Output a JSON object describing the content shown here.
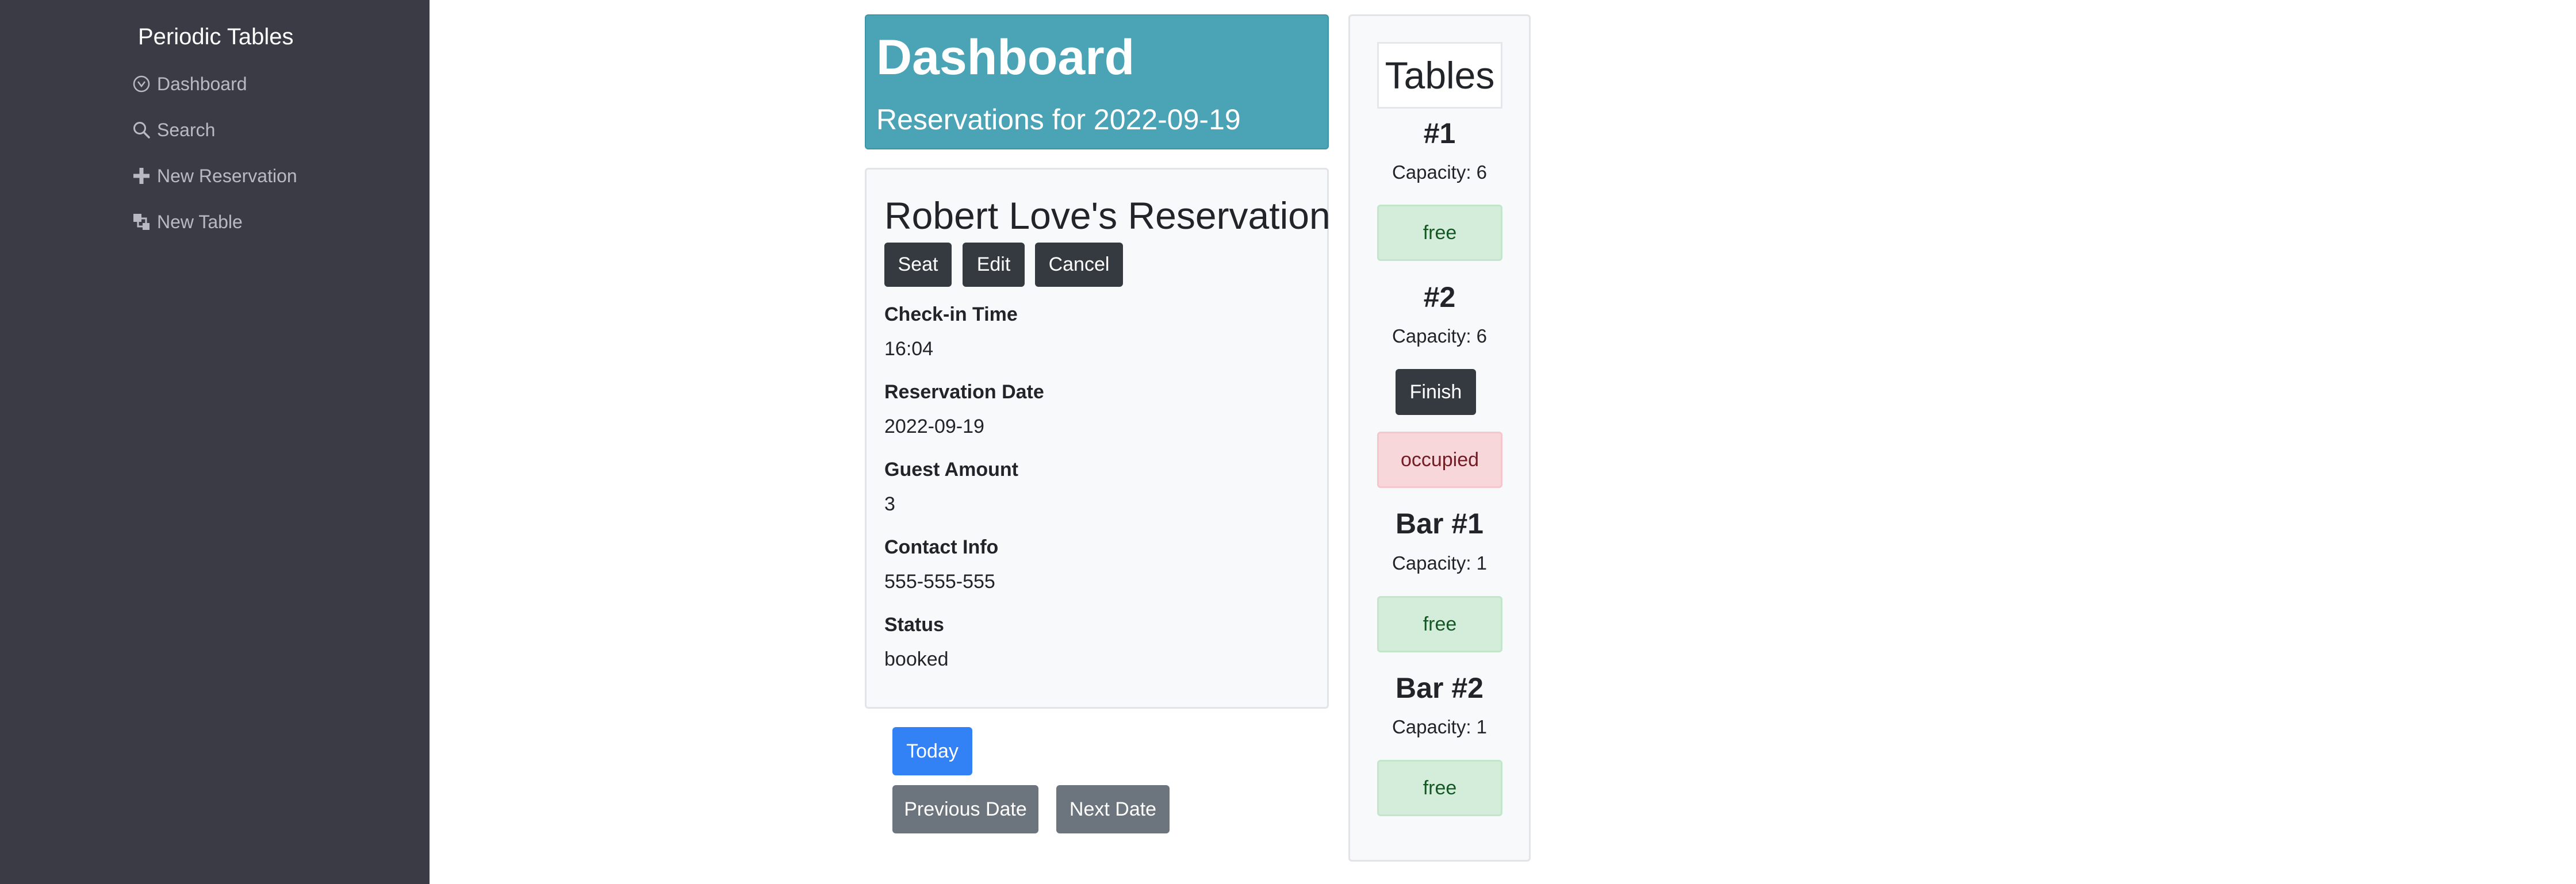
{
  "sidebar": {
    "brand": "Periodic Tables",
    "items": [
      {
        "label": "Dashboard",
        "icon": "dashboard-icon"
      },
      {
        "label": "Search",
        "icon": "search-icon"
      },
      {
        "label": "New Reservation",
        "icon": "plus-icon"
      },
      {
        "label": "New Table",
        "icon": "layers-icon"
      }
    ]
  },
  "header": {
    "title": "Dashboard",
    "subtitle": "Reservations for 2022-09-19"
  },
  "reservation": {
    "title": "Robert Love's Reservation",
    "buttons": {
      "seat": "Seat",
      "edit": "Edit",
      "cancel": "Cancel"
    },
    "fields": [
      {
        "label": "Check-in Time",
        "value": "16:04"
      },
      {
        "label": "Reservation Date",
        "value": "2022-09-19"
      },
      {
        "label": "Guest Amount",
        "value": "3"
      },
      {
        "label": "Contact Info",
        "value": "555-555-555"
      },
      {
        "label": "Status",
        "value": "booked"
      }
    ]
  },
  "date_nav": {
    "today": "Today",
    "previous": "Previous Date",
    "next": "Next Date"
  },
  "tables": {
    "heading": "Tables",
    "items": [
      {
        "name": "#1",
        "capacity": "Capacity: 6",
        "status": "free"
      },
      {
        "name": "#2",
        "capacity": "Capacity: 6",
        "status": "occupied",
        "action": "Finish"
      },
      {
        "name": "Bar #1",
        "capacity": "Capacity: 1",
        "status": "free"
      },
      {
        "name": "Bar #2",
        "capacity": "Capacity: 1",
        "status": "free"
      }
    ]
  },
  "colors": {
    "sidebar_bg": "#3a3b44",
    "header_bg": "#4ba3b6",
    "primary": "#3282f6",
    "secondary": "#6c757d",
    "dark": "#343a40",
    "free_bg": "#d4edda",
    "occupied_bg": "#f8d7da"
  }
}
